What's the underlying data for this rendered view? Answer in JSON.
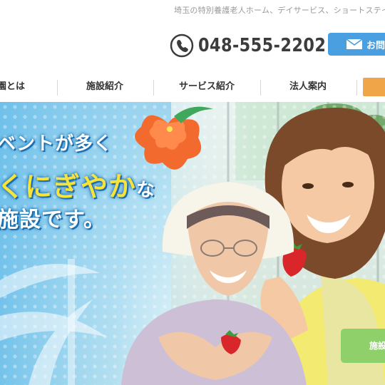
{
  "header": {
    "tagline": "埼玉の特別養護老人ホーム、デイサービス、ショートステイ",
    "phone_icon": "phone-icon",
    "phone_number": "048-555-2202",
    "contact_label": "お問",
    "contact_icon": "mail-icon"
  },
  "nav": {
    "items": [
      {
        "label": "園とは"
      },
      {
        "label": "施設紹介"
      },
      {
        "label": "サービス紹介"
      },
      {
        "label": "法人案内"
      }
    ]
  },
  "hero": {
    "line1": "ベントが多く",
    "line2_main": "くにぎやか",
    "line2_tail": "な",
    "line3": "施設です。",
    "facility_button": "施設"
  },
  "colors": {
    "contact_blue": "#4a9fe0",
    "cta_orange": "#f0a548",
    "text_yellow": "#f6e33c",
    "outline_blue": "#1d6fb0",
    "button_green": "#8fd06a"
  }
}
